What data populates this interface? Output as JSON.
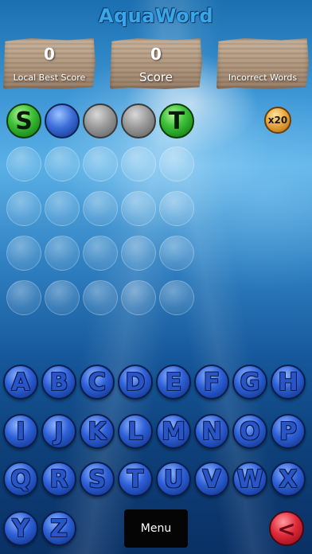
{
  "app": {
    "title": "AquaWord"
  },
  "scores": {
    "local_best": {
      "value": "0",
      "label": "Local Best Score"
    },
    "score": {
      "value": "0",
      "label": "Score"
    },
    "incorrect": {
      "value": "",
      "label": "Incorrect Words"
    }
  },
  "current_word": [
    "S",
    "",
    "",
    "",
    "T"
  ],
  "multiplier": "x20",
  "keyboard": {
    "row1": [
      "A",
      "B",
      "C",
      "D",
      "E",
      "F",
      "G",
      "H"
    ],
    "row2": [
      "I",
      "J",
      "K",
      "L",
      "M",
      "N",
      "O",
      "P"
    ],
    "row3": [
      "Q",
      "R",
      "S",
      "T",
      "U",
      "V",
      "W",
      "X"
    ],
    "row4": [
      "Y",
      "Z"
    ]
  },
  "menu_label": "Menu",
  "back_label": "<"
}
